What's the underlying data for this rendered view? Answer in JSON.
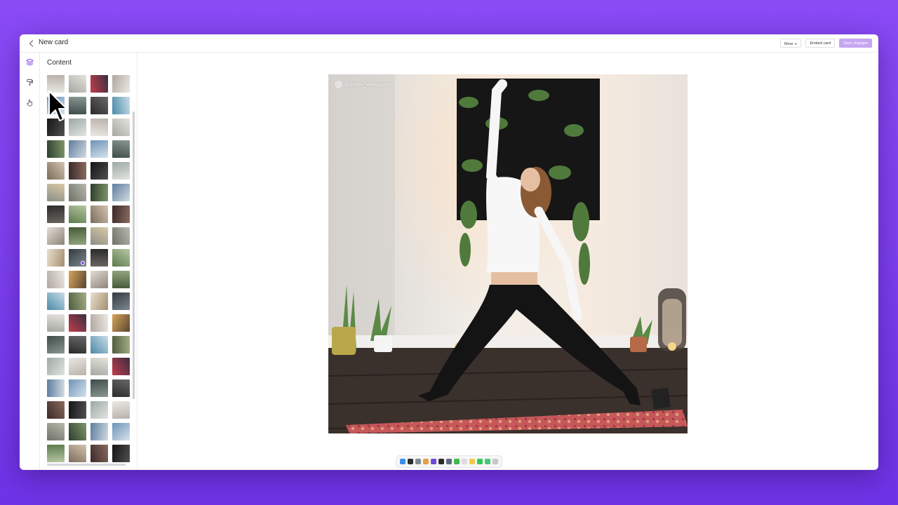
{
  "header": {
    "title": "New card",
    "more_label": "More",
    "embed_label": "Embed card",
    "save_label": "Save changes"
  },
  "sidebar": {
    "panel_title": "Content",
    "rail_icons": [
      "layers-icon",
      "paint-roller-icon",
      "hand-pointer-icon"
    ]
  },
  "preview": {
    "instagram_handle": "annices_workouts9"
  },
  "colors": {
    "accent": "#8a4bf5",
    "save_button": "#c6a6f3",
    "background": "#8a4bf5"
  }
}
